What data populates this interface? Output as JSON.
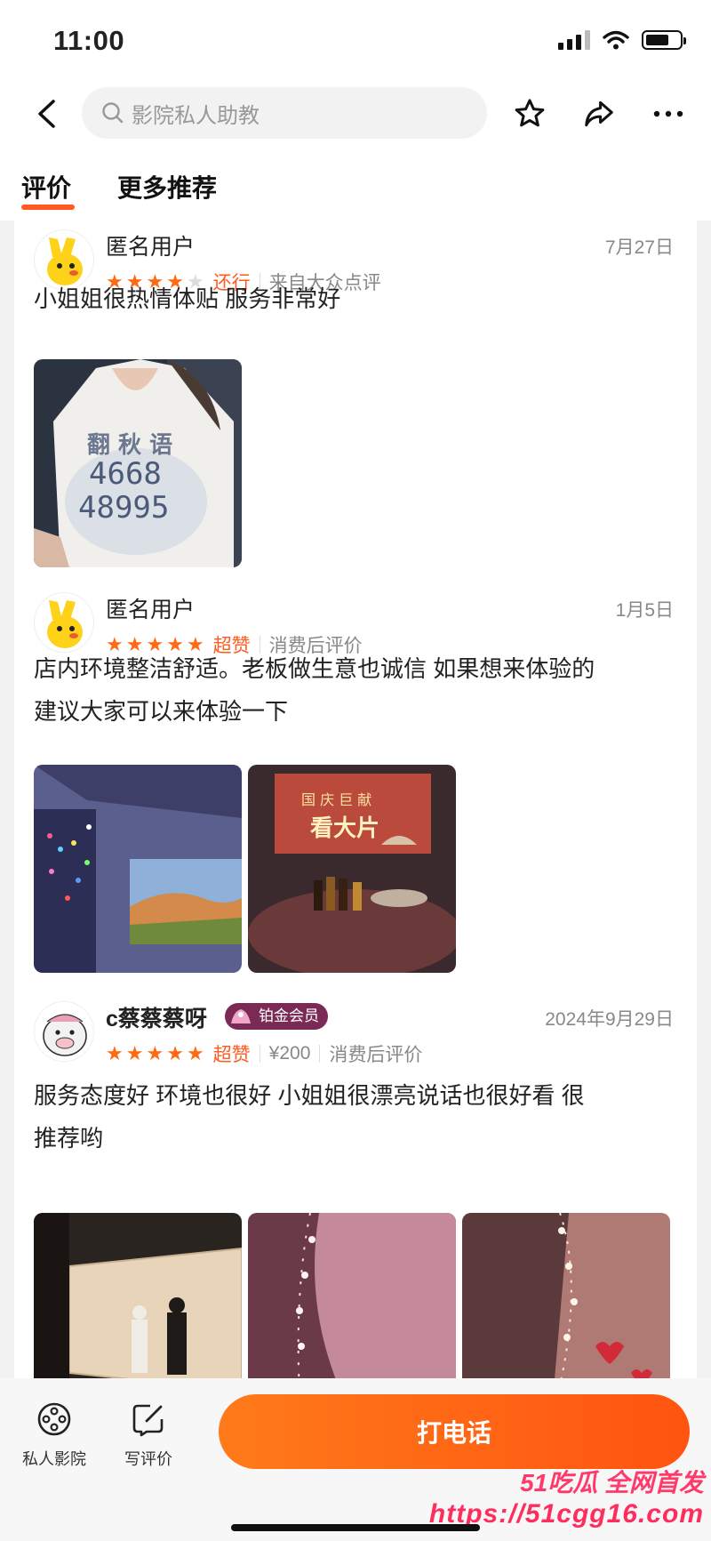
{
  "status": {
    "time": "11:00"
  },
  "search": {
    "placeholder": "影院私人助教"
  },
  "tabs": [
    {
      "label": "评价",
      "active": true
    },
    {
      "label": "更多推荐",
      "active": false
    }
  ],
  "reviews": [
    {
      "user": "匿名用户",
      "date": "7月27日",
      "stars": 4,
      "rating_word": "还行",
      "meta": [
        "来自大众点评"
      ],
      "text": "小姐姐很热情体贴 服务非常好",
      "photos": 1
    },
    {
      "user": "匿名用户",
      "date": "1月5日",
      "stars": 5,
      "rating_word": "超赞",
      "meta": [
        "消费后评价"
      ],
      "text_lines": [
        "店内环境整洁舒适。老板做生意也诚信 如果想来体验的",
        "建议大家可以来体验一下"
      ],
      "photos": 2
    },
    {
      "user": "c蔡蔡蔡呀",
      "badge": "铂金会员",
      "date": "2024年9月29日",
      "stars": 5,
      "rating_word": "超赞",
      "meta": [
        "¥200",
        "消费后评价"
      ],
      "text_lines": [
        "服务态度好 环境也很好 小姐姐很漂亮说话也很好看  很",
        "推荐哟"
      ],
      "photos": 3
    }
  ],
  "photo_texts": {
    "shirt_line1": "4668",
    "shirt_line2": "48995"
  },
  "bottom_bar": {
    "items": [
      {
        "label": "私人影院",
        "icon": "film-reel-icon"
      },
      {
        "label": "写评价",
        "icon": "edit-review-icon"
      }
    ],
    "call_label": "打电话"
  },
  "watermark": {
    "title": "51吃瓜 全网首发",
    "url": "https://51cgg16.com"
  },
  "colors": {
    "accent": "#ff5a1f",
    "star": "#ff6a14",
    "badge": "#7a2a54"
  }
}
